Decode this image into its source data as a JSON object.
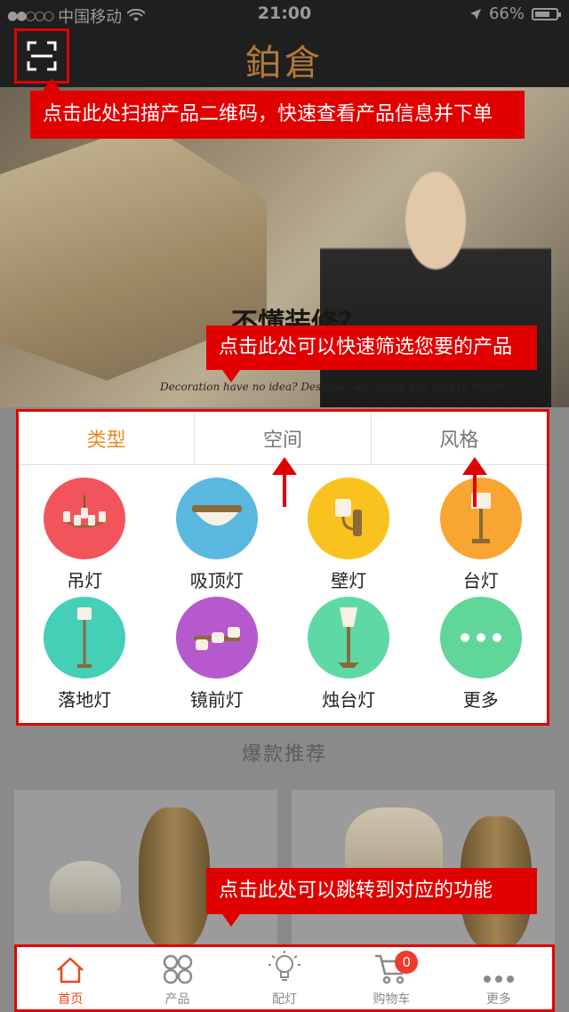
{
  "status_bar": {
    "carrier": "中国移动",
    "time": "21:00",
    "battery": "66%"
  },
  "header": {
    "logo": "鉑倉"
  },
  "banner": {
    "headline": "不懂装修？",
    "caption": "Decoration have no idea? Designer will teach you how to match."
  },
  "callouts": {
    "scan": "点击此处扫描产品二维码，快速查看产品信息并下单",
    "filter": "点击此处可以快速筛选您要的产品",
    "nav": "点击此处可以跳转到对应的功能"
  },
  "filter": {
    "tabs": [
      {
        "label": "类型",
        "active": true
      },
      {
        "label": "空间",
        "active": false
      },
      {
        "label": "风格",
        "active": false
      }
    ],
    "categories": [
      {
        "label": "吊灯",
        "color": "#f2545b",
        "icon": "chandelier-icon"
      },
      {
        "label": "吸顶灯",
        "color": "#5ab8e0",
        "icon": "ceiling-lamp-icon"
      },
      {
        "label": "壁灯",
        "color": "#f9c21f",
        "icon": "wall-lamp-icon"
      },
      {
        "label": "台灯",
        "color": "#f9a531",
        "icon": "table-lamp-icon"
      },
      {
        "label": "落地灯",
        "color": "#45cfb7",
        "icon": "floor-lamp-icon"
      },
      {
        "label": "镜前灯",
        "color": "#b659cc",
        "icon": "mirror-lamp-icon"
      },
      {
        "label": "烛台灯",
        "color": "#5ed9a6",
        "icon": "candle-lamp-icon"
      },
      {
        "label": "更多",
        "color": "#60d69a",
        "icon": "more-icon"
      }
    ]
  },
  "hot": {
    "title": "爆款推荐"
  },
  "bottom_nav": [
    {
      "label": "首页",
      "icon": "home-icon",
      "active": true
    },
    {
      "label": "产品",
      "icon": "grid-icon",
      "active": false
    },
    {
      "label": "配灯",
      "icon": "bulb-icon",
      "active": false
    },
    {
      "label": "购物车",
      "icon": "cart-icon",
      "active": false,
      "badge": "0"
    },
    {
      "label": "更多",
      "icon": "more-icon",
      "active": false
    }
  ],
  "colors": {
    "accent": "#e24a1e",
    "tab_active": "#f08a1c",
    "callout": "#e00000"
  }
}
